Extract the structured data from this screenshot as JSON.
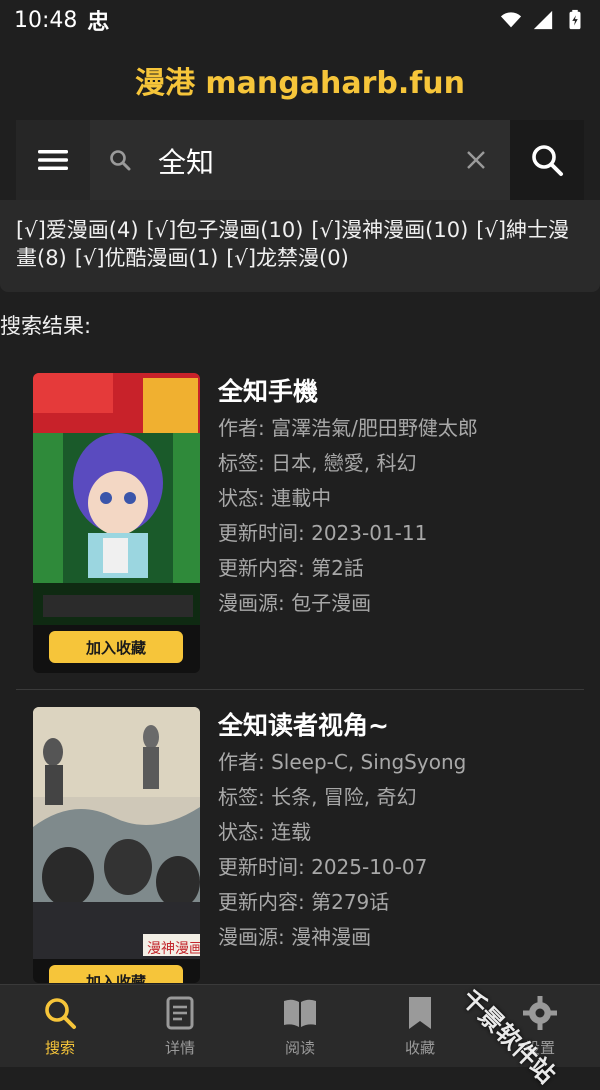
{
  "status": {
    "time": "10:48",
    "app_glyph": "忠"
  },
  "app_title": "漫港 mangaharb.fun",
  "search": {
    "value": "全知",
    "placeholder": ""
  },
  "sources": [
    "[√]爱漫画(4)",
    "[√]包子漫画(10)",
    "[√]漫神漫画(10)",
    "[√]紳士漫畫(8)",
    "[√]优酷漫画(1)",
    "[√]龙禁漫(0)"
  ],
  "results_label": "搜索结果:",
  "results": [
    {
      "title": "全知手機",
      "author": "作者: 富澤浩氣/肥田野健太郎",
      "tags": "标签: 日本, 戀愛, 科幻",
      "state": "状态: 連載中",
      "updated": "更新时间: 2023-01-11",
      "latest": "更新内容: 第2話",
      "source": "漫画源: 包子漫画",
      "fav_label": "加入收藏"
    },
    {
      "title": "全知读者视角~",
      "author": "作者: Sleep-C, SingSyong",
      "tags": "标签: 长条, 冒险, 奇幻",
      "state": "状态: 连载",
      "updated": "更新时间: 2025-10-07",
      "latest": "更新内容: 第279话",
      "source": "漫画源: 漫神漫画",
      "fav_label": "加入收藏",
      "cover_caption": "漫神漫画"
    }
  ],
  "nav": [
    {
      "label": "搜索",
      "icon": "search-icon"
    },
    {
      "label": "详情",
      "icon": "document-icon"
    },
    {
      "label": "阅读",
      "icon": "book-icon"
    },
    {
      "label": "收藏",
      "icon": "bookmark-icon"
    },
    {
      "label": "设置",
      "icon": "gear-icon"
    }
  ],
  "watermark": "千景软件站",
  "colors": {
    "accent": "#f6c53a",
    "background": "#1f1f1f",
    "nav_bg": "#2a2a2a"
  }
}
